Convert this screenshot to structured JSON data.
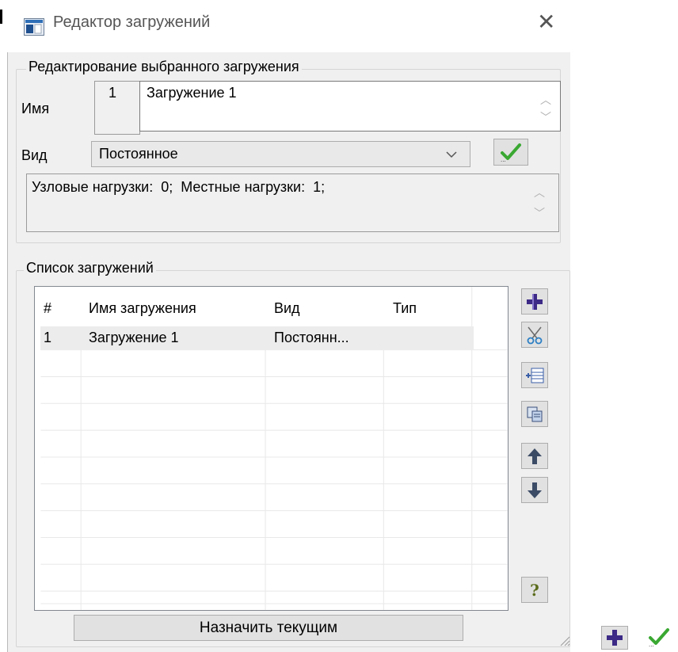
{
  "window": {
    "title": "Редактор загружений",
    "close_glyph": "✕"
  },
  "edit_group": {
    "legend": "Редактирование выбранного загружения",
    "name_label": "Имя",
    "index": "1",
    "name_value": "Загружение 1",
    "type_label": "Вид",
    "type_value": "Постоянное",
    "info": "Узловые нагрузки:  0;  Местные нагрузки:  1;"
  },
  "list_group": {
    "legend": "Список загружений",
    "columns": [
      "#",
      "Имя загружения",
      "Вид",
      "Тип"
    ],
    "rows": [
      {
        "num": "1",
        "name": "Загружение 1",
        "type": "Постоянн...",
        "kind": ""
      }
    ]
  },
  "side_buttons": [
    {
      "icon": "plus-icon"
    },
    {
      "icon": "scissors-icon"
    },
    {
      "icon": "insert-rows-icon"
    },
    {
      "icon": "copy-icon"
    },
    {
      "icon": "arrow-up-icon"
    },
    {
      "icon": "arrow-down-icon"
    },
    {
      "icon": "help-icon",
      "glyph": "?"
    }
  ],
  "assign_button": "Назначить текущим",
  "colors": {
    "plus": "#3c2a86",
    "check": "#3aa832",
    "arrow": "#3b4b66",
    "help": "#5a6b1a"
  }
}
